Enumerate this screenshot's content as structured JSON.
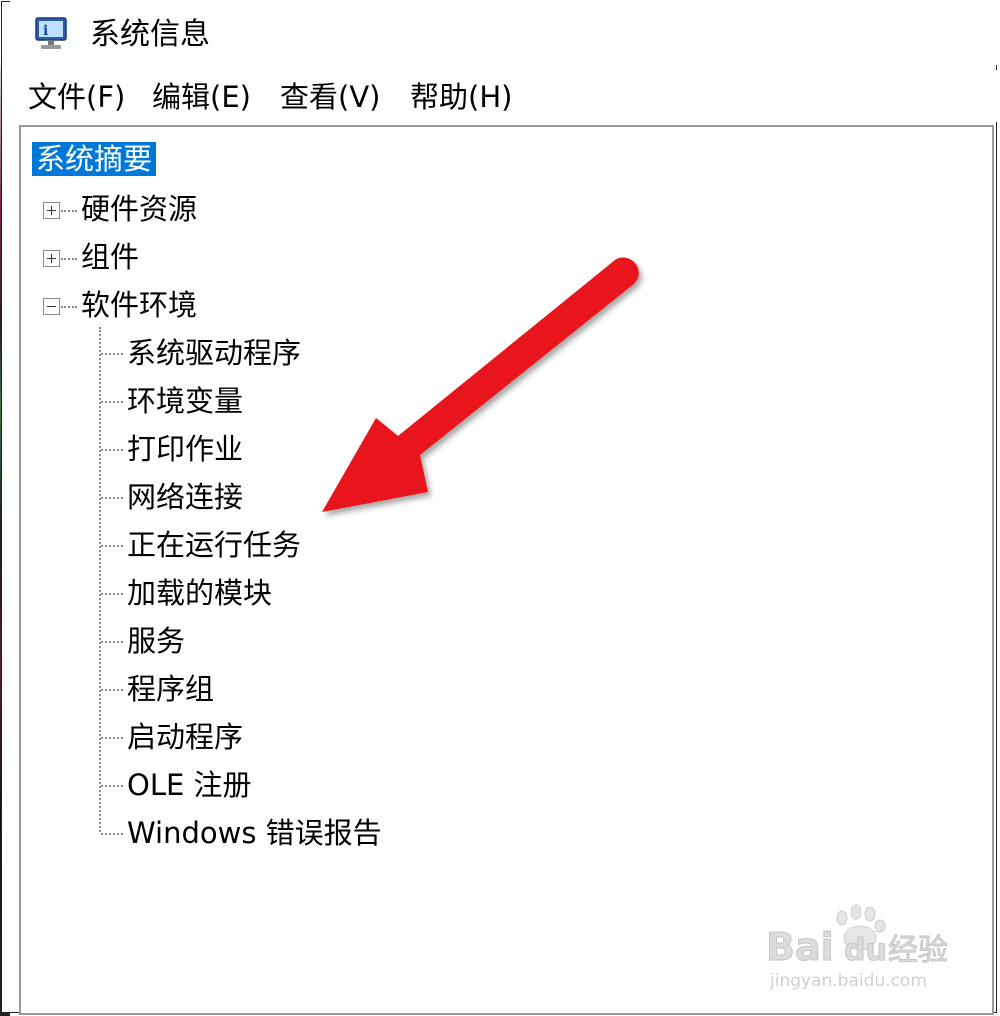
{
  "window": {
    "title": "系统信息",
    "icon": "system-info-icon"
  },
  "menu": {
    "items": [
      "文件(F)",
      "编辑(E)",
      "查看(V)",
      "帮助(H)"
    ]
  },
  "tree": {
    "root": "系统摘要",
    "nodes": [
      {
        "label": "硬件资源",
        "state": "collapsed"
      },
      {
        "label": "组件",
        "state": "collapsed"
      },
      {
        "label": "软件环境",
        "state": "expanded"
      }
    ],
    "software_children": [
      "系统驱动程序",
      "环境变量",
      "打印作业",
      "网络连接",
      "正在运行任务",
      "加载的模块",
      "服务",
      "程序组",
      "启动程序",
      "OLE 注册",
      "Windows 错误报告"
    ]
  },
  "annotation": {
    "arrow_color": "#e8171b"
  },
  "watermark": {
    "brand": "Bai",
    "brand2": "du",
    "suffix": "经验",
    "url": "jingyan.baidu.com"
  },
  "colors": {
    "selection": "#0078d7"
  }
}
